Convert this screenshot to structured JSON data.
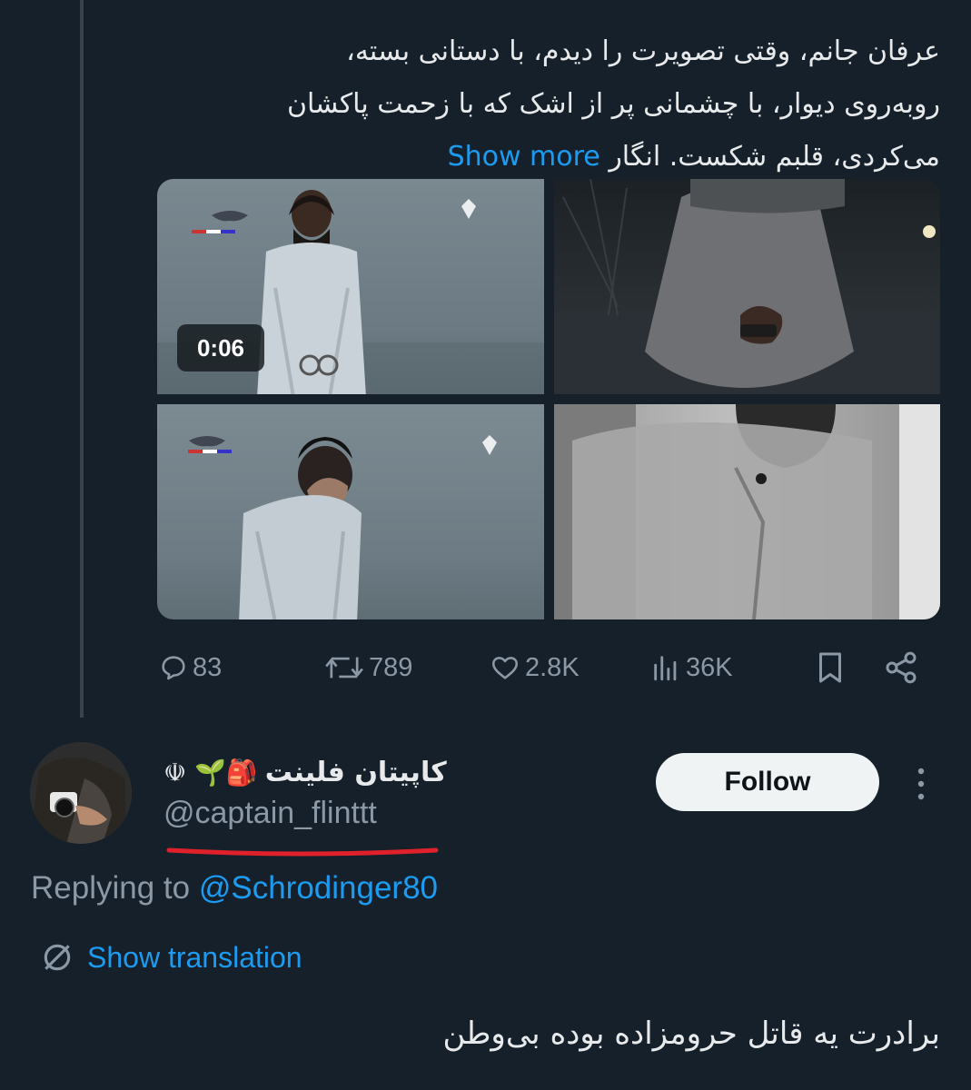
{
  "tweet": {
    "text": "عرفان جانم، وقتی تصویرت را دیدم، با دستانی بسته، روبه‌روی دیوار، با چشمانی پر از اشک که با زحمت پاکشان می‌کردی، قلبم شکست. انگار",
    "show_more": "Show more",
    "video_duration": "0:06",
    "stats": {
      "replies": "83",
      "retweets": "789",
      "likes": "2.8K",
      "views": "36K"
    }
  },
  "reply": {
    "display_name": "کاپیتان فلینت",
    "name_emojis": "☫ 🌱🎒",
    "handle": "@captain_flinttt",
    "follow_label": "Follow",
    "replying_prefix": "Replying to ",
    "replying_to": "@Schrodinger80",
    "show_translation": "Show translation",
    "text": "برادرت یه قاتل حرومزاده بوده بی‌وطن"
  },
  "icons": {
    "reply": "comment-icon",
    "retweet": "retweet-icon",
    "like": "heart-icon",
    "views": "bar-chart-icon",
    "bookmark": "bookmark-icon",
    "share": "share-icon",
    "more": "vertical-dots-icon",
    "translate": "globe-icon"
  },
  "colors": {
    "background": "#15202b",
    "text": "#e7e9ea",
    "muted": "#8b98a5",
    "link": "#1d9bf0",
    "annotation_underline": "#e0202a"
  }
}
